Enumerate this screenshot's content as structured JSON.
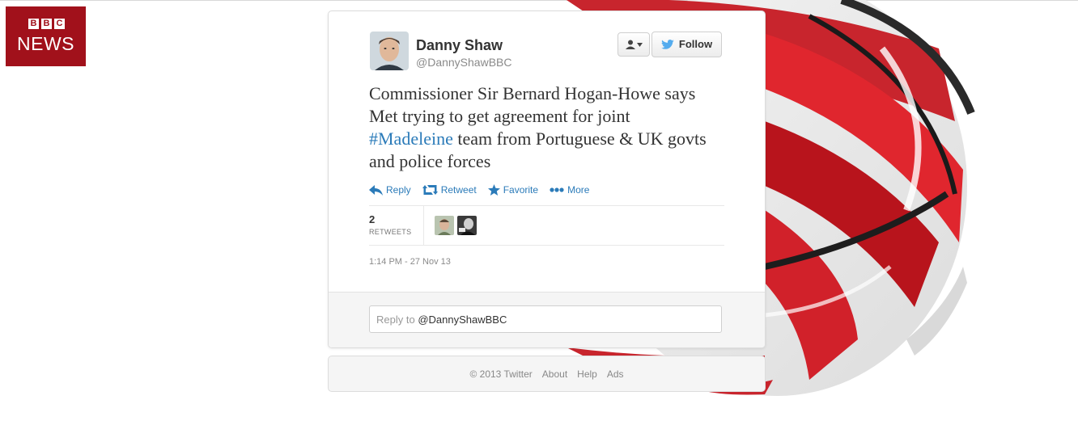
{
  "brand": {
    "blocks": [
      "B",
      "B",
      "C"
    ],
    "news": "NEWS",
    "color": "#a1111b"
  },
  "tweet": {
    "author_name": "Danny Shaw",
    "author_handle": "@DannyShawBBC",
    "follow_label": "Follow",
    "text_before": "Commissioner Sir Bernard Hogan-Howe says Met trying to get agreement for joint ",
    "hashtag": "#Madeleine",
    "text_after": " team from Portuguese & UK govts and police forces",
    "actions": {
      "reply": "Reply",
      "retweet": "Retweet",
      "favorite": "Favorite",
      "more": "More"
    },
    "retweets_count": "2",
    "retweets_label": "RETWEETS",
    "timestamp": "1:14 PM - 27 Nov 13",
    "reply_prefix": "Reply to ",
    "reply_mention": "@DannyShawBBC"
  },
  "footer": {
    "copyright": "© 2013 Twitter",
    "about": "About",
    "help": "Help",
    "ads": "Ads"
  },
  "colors": {
    "link": "#2b7bb9",
    "twitter_bird": "#55acee"
  }
}
